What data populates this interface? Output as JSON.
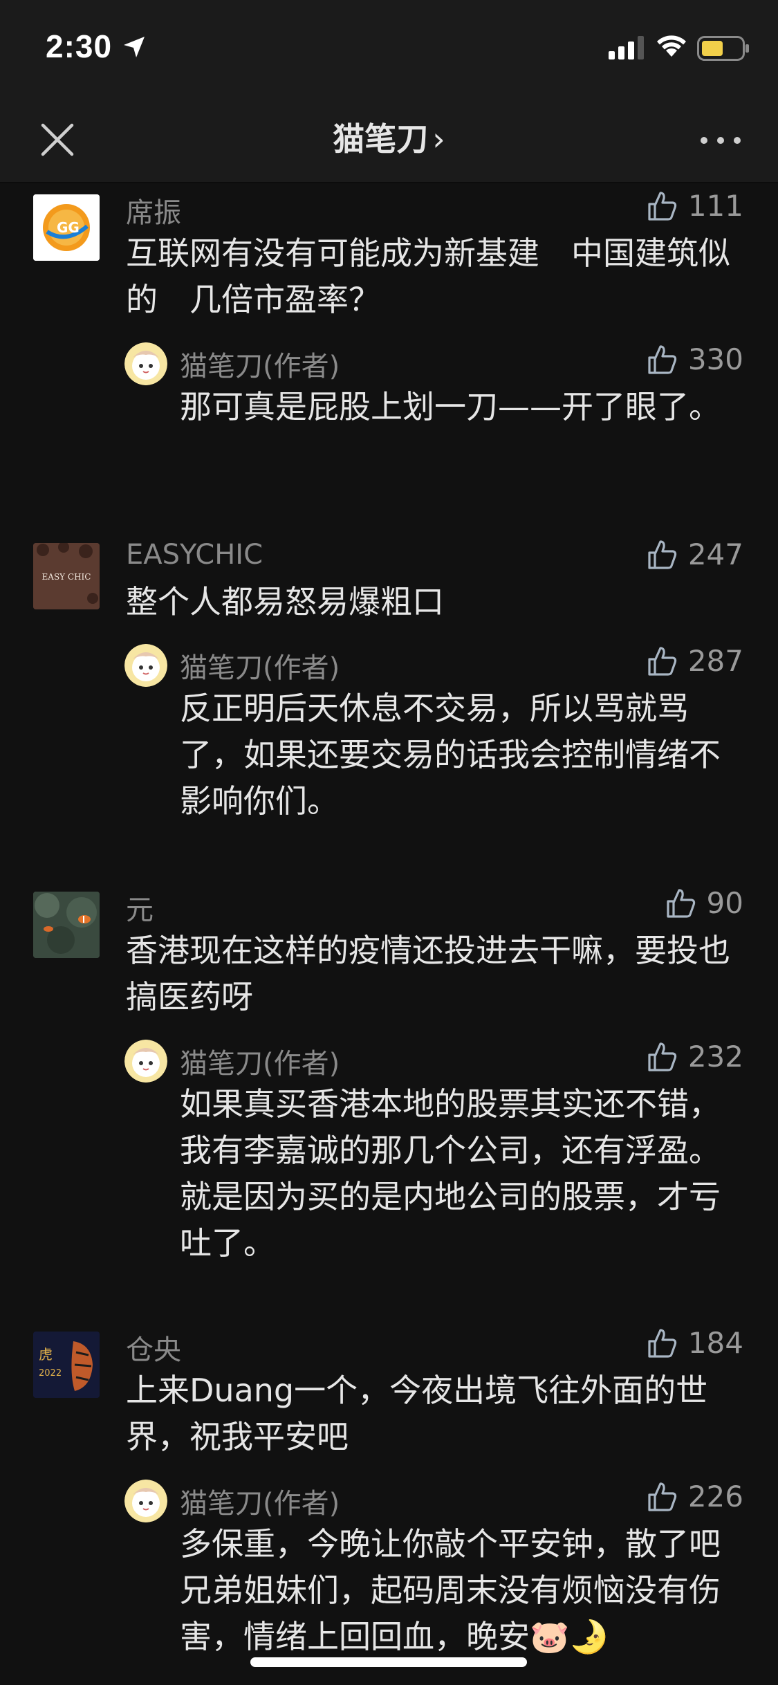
{
  "status": {
    "time": "2:30"
  },
  "header": {
    "title": "猫笔刀",
    "chevron": "›"
  },
  "comments": [
    {
      "author": "席振",
      "likes": "111",
      "text": "互联网有没有可能成为新基建　中国建筑似的　几倍市盈率？",
      "reply": {
        "author": "猫笔刀(作者)",
        "likes": "330",
        "text": "那可真是屁股上划一刀——开了眼了。"
      }
    },
    {
      "author": "EASYCHIC",
      "avatar_text": "EASY CHIC",
      "likes": "247",
      "text": "整个人都易怒易爆粗口",
      "reply": {
        "author": "猫笔刀(作者)",
        "likes": "287",
        "text": "反正明后天休息不交易，所以骂就骂了，如果还要交易的话我会控制情绪不影响你们。"
      }
    },
    {
      "author": "元",
      "likes": "90",
      "text": "香港现在这样的疫情还投进去干嘛，要投也搞医药呀",
      "reply": {
        "author": "猫笔刀(作者)",
        "likes": "232",
        "text": "如果真买香港本地的股票其实还不错，我有李嘉诚的那几个公司，还有浮盈。就是因为买的是内地公司的股票，才亏吐了。"
      }
    },
    {
      "author": "仓央",
      "likes": "184",
      "text": "上来Duang一个，今夜出境飞往外面的世界，祝我平安吧",
      "reply": {
        "author": "猫笔刀(作者)",
        "likes": "226",
        "text": "多保重，今晚让你敲个平安钟，散了吧兄弟姐妹们，起码周末没有烦恼没有伤害，情绪上回回血，晚安🐷🌛"
      }
    }
  ],
  "colors": {
    "background": "#111111",
    "bar": "#1b1b1b",
    "name": "#8a8a8a",
    "text": "#e6e6e6"
  }
}
